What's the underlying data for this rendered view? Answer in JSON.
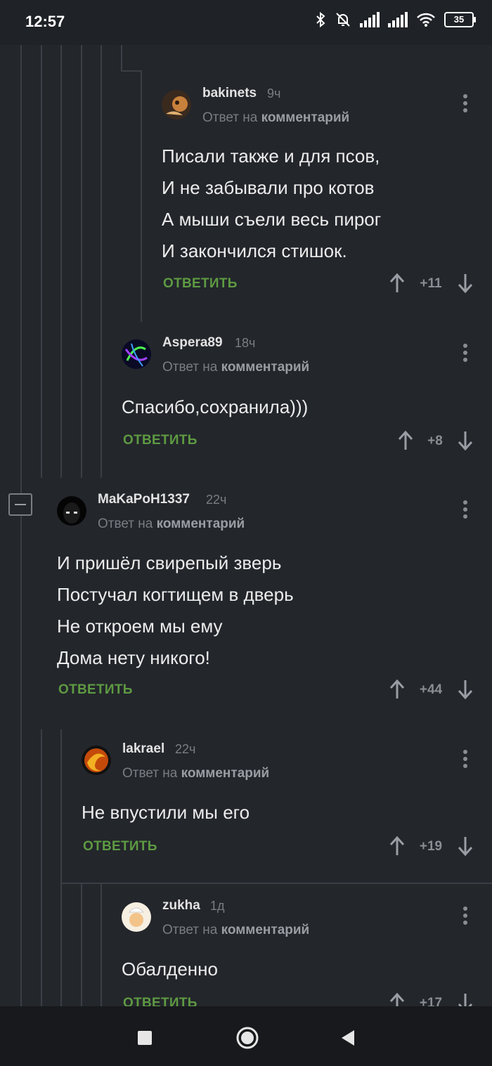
{
  "status_bar": {
    "time": "12:57",
    "battery": "35"
  },
  "reply_to_label": "Ответ на",
  "reply_to_link": "комментарий",
  "reply_button_label": "ОТВЕТИТЬ",
  "colors": {
    "accent_green": "#5e9a42",
    "background": "#23262b",
    "thread_line": "#3b3f45"
  },
  "comments": [
    {
      "user": "bakinets",
      "time": "9ч",
      "lines": [
        "Писали также и для псов,",
        "И не забывали про котов",
        "А мыши съели весь пирог",
        "И закончился стишок."
      ],
      "score": "+11"
    },
    {
      "user": "Aspera89",
      "time": "18ч",
      "lines": [
        "Спасибо,сохранила)))"
      ],
      "score": "+8"
    },
    {
      "user": "MaKaPoH1337",
      "time": "22ч",
      "lines": [
        "И пришёл свирепый зверь",
        "Постучал когтищем в дверь",
        "Не откроем мы ему",
        "Дома нету никого!"
      ],
      "score": "+44"
    },
    {
      "user": "lakrael",
      "time": "22ч",
      "lines": [
        "Не впустили мы его"
      ],
      "score": "+19"
    },
    {
      "user": "zukha",
      "time": "1д",
      "lines": [
        "Обалденно"
      ],
      "score": "+17"
    }
  ],
  "nav": {
    "recent": "square-icon",
    "home": "circle-icon",
    "back": "triangle-back-icon"
  }
}
